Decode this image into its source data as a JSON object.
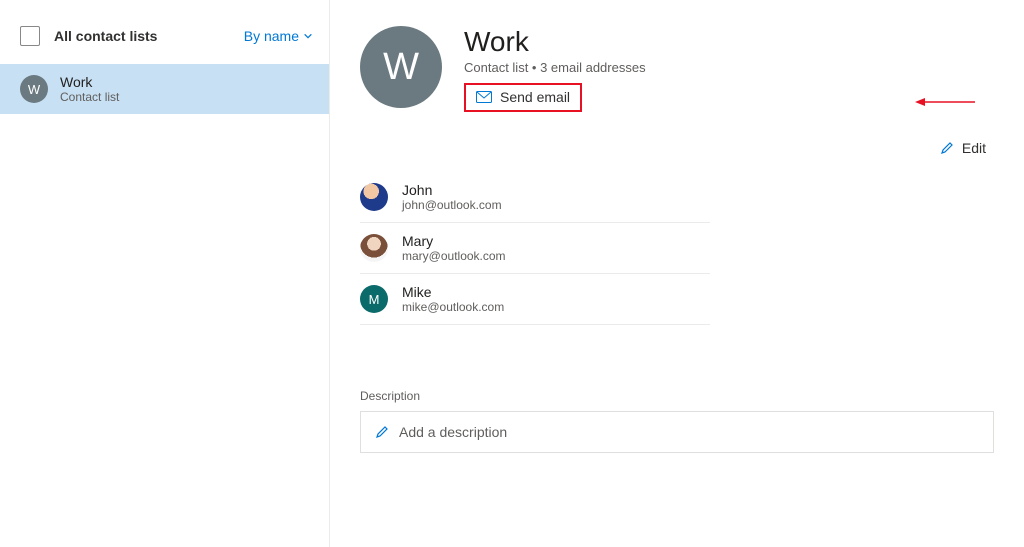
{
  "sidebar": {
    "title": "All contact lists",
    "sort_label": "By name",
    "items": [
      {
        "initial": "W",
        "name": "Work",
        "subtitle": "Contact list"
      }
    ]
  },
  "header": {
    "initial": "W",
    "title": "Work",
    "subtitle": "Contact list • 3 email addresses",
    "send_email_label": "Send email",
    "edit_label": "Edit"
  },
  "contacts": [
    {
      "name": "John",
      "email": "john@outlook.com",
      "avatar_type": "photo-john"
    },
    {
      "name": "Mary",
      "email": "mary@outlook.com",
      "avatar_type": "photo-mary"
    },
    {
      "name": "Mike",
      "email": "mike@outlook.com",
      "avatar_type": "initial",
      "initial": "M"
    }
  ],
  "description": {
    "label": "Description",
    "placeholder": "Add a description"
  }
}
